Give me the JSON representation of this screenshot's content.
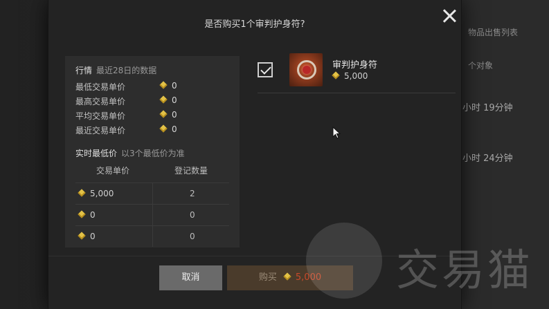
{
  "background": {
    "texts": [
      "物品出售列表",
      "个对象",
      "小时 19分钟",
      "小时 24分钟"
    ]
  },
  "dialog": {
    "title": "是否购买1个审判护身符?",
    "close_icon": "close-icon"
  },
  "market": {
    "header": "行情",
    "header_sub": "最近28日的数据",
    "rows": [
      {
        "label": "最低交易单价",
        "value": "0"
      },
      {
        "label": "最高交易单价",
        "value": "0"
      },
      {
        "label": "平均交易单价",
        "value": "0"
      },
      {
        "label": "最近交易单价",
        "value": "0"
      }
    ],
    "realtime_title": "实时最低价",
    "realtime_sub": "以3个最低价为准",
    "table_headers": [
      "交易单价",
      "登记数量"
    ],
    "table_rows": [
      {
        "price": "5,000",
        "qty": "2"
      },
      {
        "price": "0",
        "qty": "0"
      },
      {
        "price": "0",
        "qty": "0"
      }
    ]
  },
  "item": {
    "name": "审判护身符",
    "price": "5,000",
    "checked": true,
    "icon": "amulet-icon"
  },
  "buttons": {
    "cancel": "取消",
    "buy": "购买",
    "buy_price": "5,000"
  },
  "watermark": {
    "text": "交易猫"
  },
  "colors": {
    "gem": "#e3c247",
    "buy_price": "#c94a2b",
    "cancel_bg": "#6a6a6a"
  }
}
